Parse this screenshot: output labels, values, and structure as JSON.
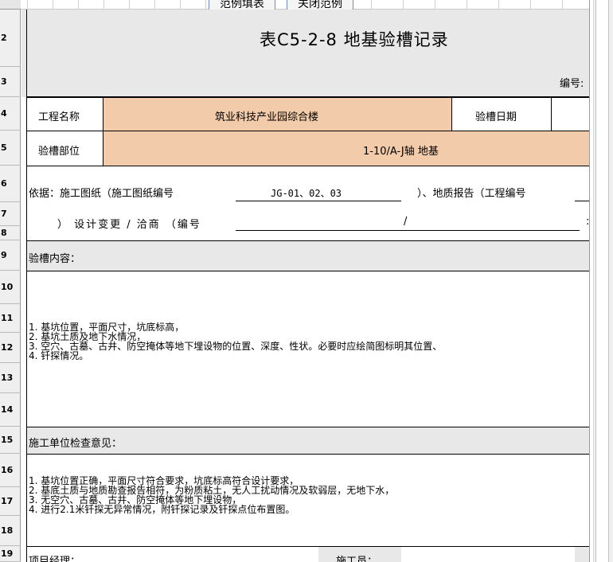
{
  "toolbar": {
    "example_fill": "范例填表",
    "close_example": "关闭范例"
  },
  "row_numbers": [
    "2",
    "3",
    "4",
    "5",
    "6",
    "7",
    "8",
    "9",
    "10",
    "11",
    "12",
    "13",
    "14",
    "15",
    "16",
    "17",
    "18",
    "19"
  ],
  "form": {
    "title": "表C5-2-8 地基验槽记录",
    "number_label": "编号:",
    "project_name_label": "工程名称",
    "project_name_value": "筑业科技产业园综合楼",
    "inspection_date_label": "验槽日期",
    "inspection_date_value": "",
    "inspection_location_label": "验槽部位",
    "inspection_location_value": "1-10/A-J轴 地基",
    "basis_prefix": "依据：施工图纸（施工图纸编号",
    "drawing_numbers": "JG-01、02、03",
    "basis_middle": "）、地质报告（工程编号",
    "geo_report_number": "",
    "design_change_text": "） 设计变更 / 洽商 （编号",
    "design_change_number": "/",
    "inspection_content_label": "验槽内容：",
    "inspection_items": [
      "1. 基坑位置，平面尺寸，坑底标高，",
      "2. 基坑土质及地下水情况，",
      "3. 空穴、古墓、古井、防空掩体等地下埋设物的位置、深度、性状。必要时应绘简图标明其位置、",
      "4. 钎探情况。"
    ],
    "construction_opinion_label": "施工单位检查意见：",
    "construction_opinion_items": [
      "1. 基坑位置正确，平面尺寸符合要求，坑底标高符合设计要求，",
      "2. 基底土质与地质勘查报告相符，为粉质粘土，无人工扰动情况及软弱层，无地下水，",
      "3. 无空穴、古墓、古井、防空掩体等地下埋设物，",
      "4. 进行2.1米钎探无异常情况，附钎探记录及钎探点位布置图。"
    ],
    "project_manager_label": "项目经理：",
    "constructor_label": "施工员："
  }
}
